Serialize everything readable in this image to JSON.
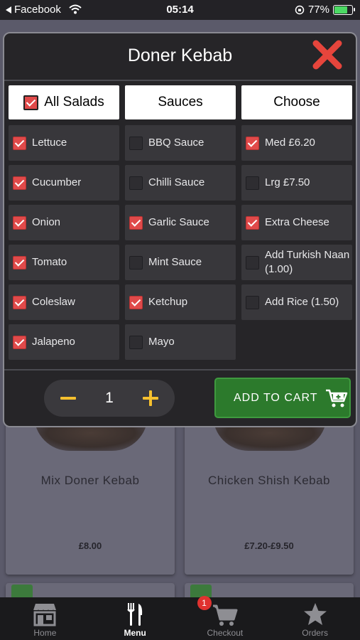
{
  "status_bar": {
    "back_label": "Facebook",
    "time": "05:14",
    "battery": "77%"
  },
  "background_menu": {
    "items": [
      {
        "name": "Mix Doner Kebab",
        "price": "£8.00"
      },
      {
        "name": "Chicken Shish Kebab",
        "price": "£7.20-£9.50"
      }
    ]
  },
  "modal": {
    "title": "Doner Kebab",
    "close_icon": "close-x-icon",
    "accent_color": "#e04a4a",
    "columns": [
      {
        "header": "All Salads",
        "header_checked": true,
        "options": [
          {
            "label": "Lettuce",
            "checked": true
          },
          {
            "label": "Cucumber",
            "checked": true
          },
          {
            "label": "Onion",
            "checked": true
          },
          {
            "label": "Tomato",
            "checked": true
          },
          {
            "label": "Coleslaw",
            "checked": true
          },
          {
            "label": "Jalapeno",
            "checked": true
          }
        ]
      },
      {
        "header": "Sauces",
        "options": [
          {
            "label": "BBQ Sauce",
            "checked": false
          },
          {
            "label": "Chilli Sauce",
            "checked": false
          },
          {
            "label": "Garlic Sauce",
            "checked": true
          },
          {
            "label": "Mint Sauce",
            "checked": false
          },
          {
            "label": "Ketchup",
            "checked": true
          },
          {
            "label": "Mayo",
            "checked": false
          }
        ]
      },
      {
        "header": "Choose",
        "options": [
          {
            "label": "Med £6.20",
            "checked": true
          },
          {
            "label": "Lrg £7.50",
            "checked": false
          },
          {
            "label": "Extra Cheese",
            "checked": true
          },
          {
            "label": "Add Turkish Naan (1.00)",
            "checked": false
          },
          {
            "label": "Add Rice (1.50)",
            "checked": false
          }
        ]
      }
    ],
    "quantity": "1",
    "add_to_cart_label": "ADD TO CART",
    "cart_button_color": "#2c7a2c"
  },
  "tabbar": {
    "tabs": [
      {
        "label": "Home",
        "icon": "store-icon"
      },
      {
        "label": "Menu",
        "icon": "fork-knife-icon",
        "active": true
      },
      {
        "label": "Checkout",
        "icon": "cart-icon",
        "badge": "1"
      },
      {
        "label": "Orders",
        "icon": "star-icon"
      }
    ]
  }
}
